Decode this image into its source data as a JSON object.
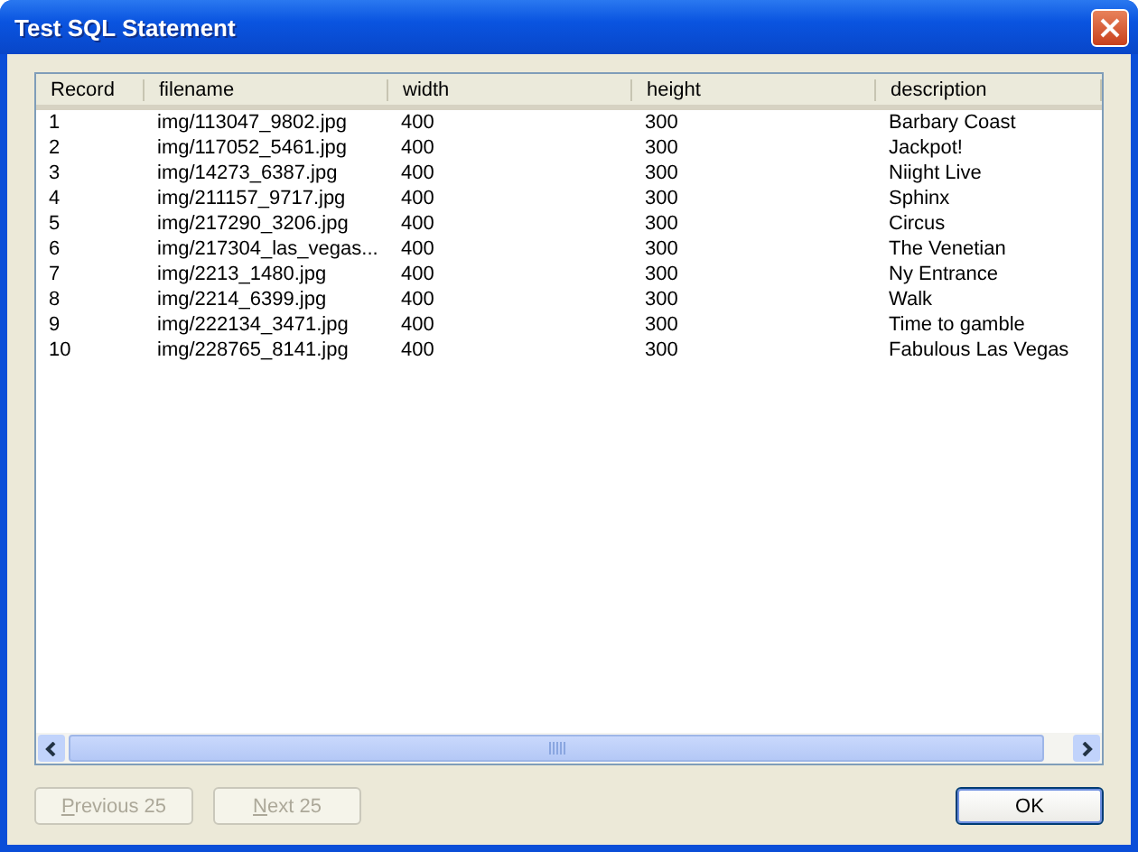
{
  "window": {
    "title": "Test SQL Statement"
  },
  "table": {
    "columns": [
      "Record",
      "filename",
      "width",
      "height",
      "description"
    ],
    "rows": [
      [
        "1",
        "img/113047_9802.jpg",
        "400",
        "300",
        "Barbary Coast"
      ],
      [
        "2",
        "img/117052_5461.jpg",
        "400",
        "300",
        "Jackpot!"
      ],
      [
        "3",
        "img/14273_6387.jpg",
        "400",
        "300",
        "Niight Live"
      ],
      [
        "4",
        "img/211157_9717.jpg",
        "400",
        "300",
        "Sphinx"
      ],
      [
        "5",
        "img/217290_3206.jpg",
        "400",
        "300",
        "Circus"
      ],
      [
        "6",
        "img/217304_las_vegas...",
        "400",
        "300",
        "The Venetian"
      ],
      [
        "7",
        "img/2213_1480.jpg",
        "400",
        "300",
        "Ny Entrance"
      ],
      [
        "8",
        "img/2214_6399.jpg",
        "400",
        "300",
        "Walk"
      ],
      [
        "9",
        "img/222134_3471.jpg",
        "400",
        "300",
        "Time to gamble"
      ],
      [
        "10",
        "img/228765_8141.jpg",
        "400",
        "300",
        "Fabulous Las Vegas"
      ]
    ]
  },
  "buttons": [
    {
      "label": "Previous 25",
      "disabled": true
    },
    {
      "label": "Next 25",
      "disabled": true
    },
    {
      "label": "OK",
      "disabled": false,
      "default": true
    }
  ]
}
